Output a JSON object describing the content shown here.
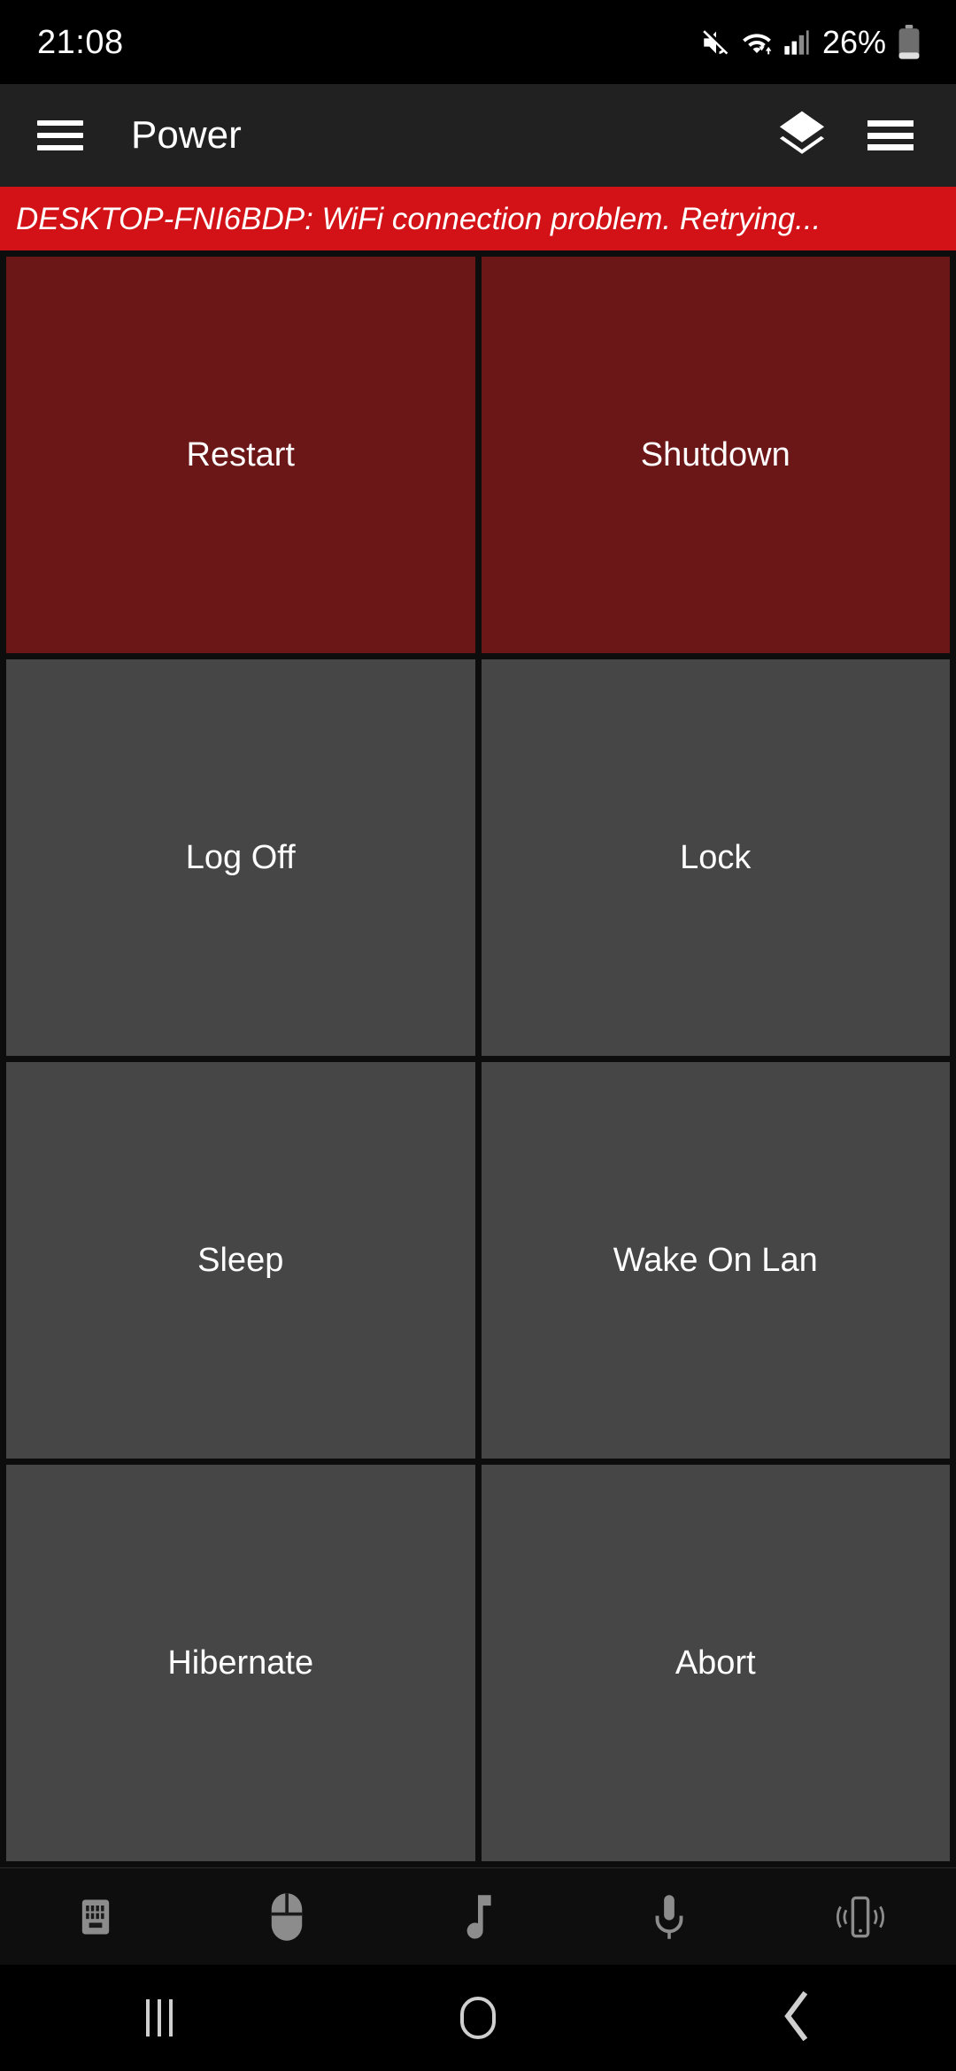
{
  "statusbar": {
    "clock": "21:08",
    "battery_percent": "26%",
    "icons": [
      "mute-icon",
      "wifi-icon",
      "cellular-signal-icon",
      "battery-icon"
    ]
  },
  "appbar": {
    "title": "Power",
    "menu_icon": "hamburger-menu-icon",
    "layers_icon": "layers-icon",
    "overflow_icon": "overflow-menu-icon"
  },
  "banner": {
    "text": "DESKTOP-FNI6BDP: WiFi connection problem. Retrying...",
    "background": "#d31217",
    "color": "#ffffff"
  },
  "colors": {
    "danger_tile": "#6b1717",
    "normal_tile": "#464646",
    "appbar": "#212121",
    "page_background": "#0d0d0d"
  },
  "grid": {
    "tiles": [
      {
        "label": "Restart",
        "style": "danger"
      },
      {
        "label": "Shutdown",
        "style": "danger"
      },
      {
        "label": "Log Off",
        "style": "normal"
      },
      {
        "label": "Lock",
        "style": "normal"
      },
      {
        "label": "Sleep",
        "style": "normal"
      },
      {
        "label": "Wake On Lan",
        "style": "normal"
      },
      {
        "label": "Hibernate",
        "style": "normal"
      },
      {
        "label": "Abort",
        "style": "normal"
      }
    ]
  },
  "bottombar": {
    "items": [
      {
        "icon": "keyboard-icon"
      },
      {
        "icon": "mouse-icon"
      },
      {
        "icon": "music-note-icon"
      },
      {
        "icon": "microphone-icon"
      },
      {
        "icon": "vibrate-phone-icon"
      }
    ]
  },
  "navbar": {
    "items": [
      {
        "icon": "recents-icon"
      },
      {
        "icon": "home-icon"
      },
      {
        "icon": "back-icon"
      }
    ]
  }
}
